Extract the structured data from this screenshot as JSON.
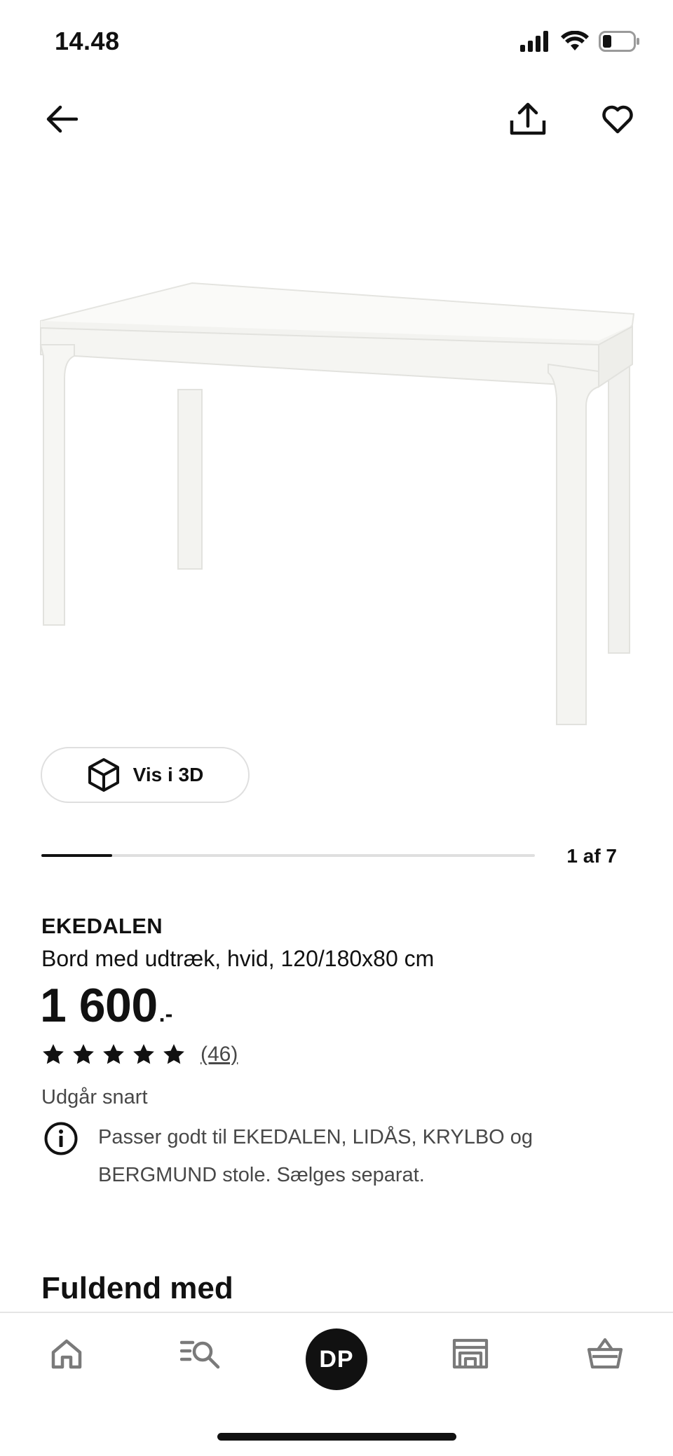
{
  "status_bar": {
    "time": "14.48"
  },
  "product": {
    "name": "EKEDALEN",
    "description": "Bord med udtræk, hvid, 120/180x80 cm",
    "price": "1 600",
    "price_suffix": ".-",
    "rating": {
      "stars": 5,
      "max_stars": 5,
      "review_count": "(46)"
    },
    "availability": "Udgår snart",
    "info_note": "Passer godt til EKEDALEN, LIDÅS, KRYLBO og BERGMUND stole. Sælges separat."
  },
  "gallery": {
    "view_3d_label": "Vis i 3D",
    "counter": "1 af 7",
    "progress": 0.143
  },
  "section": {
    "title": "Fuldend med"
  },
  "bottom_nav": {
    "profile_initials": "DP",
    "items": [
      "home-icon",
      "search-icon",
      "profile-avatar",
      "store-icon",
      "basket-icon"
    ]
  },
  "colors": {
    "text": "#111111",
    "muted": "#484848",
    "border": "#dfdfdf",
    "avatar_bg": "#111111",
    "nav_icon": "#7a7a7a"
  }
}
